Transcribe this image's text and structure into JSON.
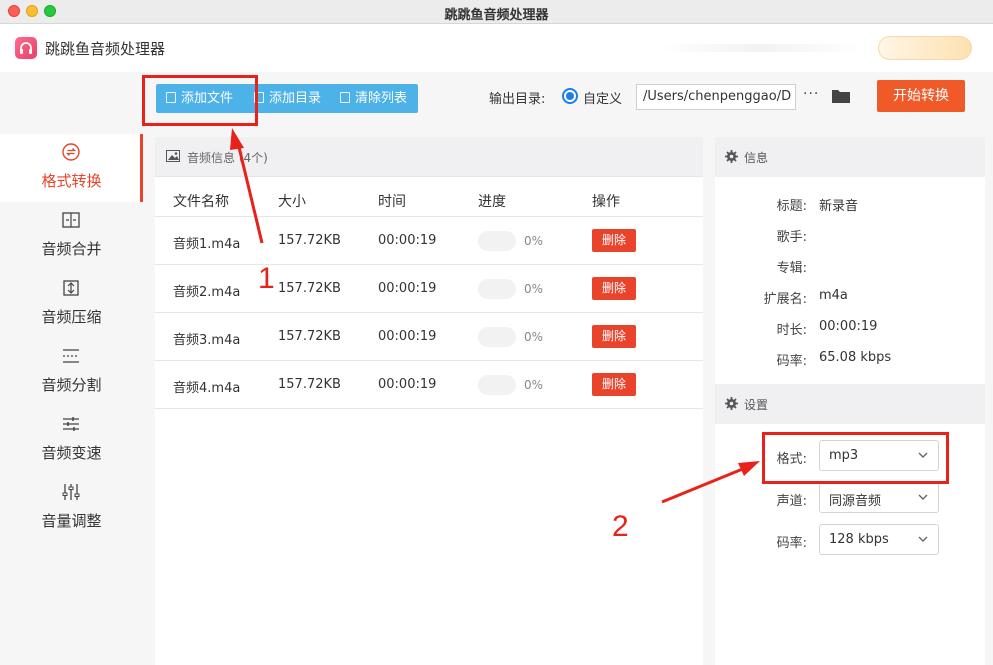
{
  "window": {
    "title": "跳跳鱼音频处理器"
  },
  "app": {
    "name": "跳跳鱼音频处理器"
  },
  "sidebar": {
    "items": [
      {
        "label": "格式转换",
        "icon": "format-convert-icon",
        "active": true
      },
      {
        "label": "音频合并",
        "icon": "merge-icon"
      },
      {
        "label": "音频压缩",
        "icon": "compress-icon"
      },
      {
        "label": "音频分割",
        "icon": "split-icon"
      },
      {
        "label": "音频变速",
        "icon": "speed-icon"
      },
      {
        "label": "音量调整",
        "icon": "volume-adjust-icon"
      }
    ]
  },
  "toolbar": {
    "add_file": "添加文件",
    "add_dir": "添加目录",
    "clear_list": "清除列表",
    "output_label": "输出目录:",
    "radio_custom": "自定义",
    "output_path": "/Users/chenpenggao/D",
    "more": "···",
    "start": "开始转换"
  },
  "file_panel": {
    "title": "音频信息 (4个)",
    "columns": [
      "文件名称",
      "大小",
      "时间",
      "进度",
      "操作"
    ],
    "rows": [
      {
        "name": "音频1.m4a",
        "size": "157.72KB",
        "time": "00:00:19",
        "progress": "0%",
        "action": "删除"
      },
      {
        "name": "音频2.m4a",
        "size": "157.72KB",
        "time": "00:00:19",
        "progress": "0%",
        "action": "删除"
      },
      {
        "name": "音频3.m4a",
        "size": "157.72KB",
        "time": "00:00:19",
        "progress": "0%",
        "action": "删除"
      },
      {
        "name": "音频4.m4a",
        "size": "157.72KB",
        "time": "00:00:19",
        "progress": "0%",
        "action": "删除"
      }
    ]
  },
  "info": {
    "title": "信息",
    "fields": [
      {
        "k": "标题:",
        "v": "新录音"
      },
      {
        "k": "歌手:",
        "v": ""
      },
      {
        "k": "专辑:",
        "v": ""
      },
      {
        "k": "扩展名:",
        "v": "m4a"
      },
      {
        "k": "时长:",
        "v": "00:00:19"
      },
      {
        "k": "码率:",
        "v": "65.08 kbps"
      }
    ]
  },
  "settings": {
    "title": "设置",
    "format_label": "格式:",
    "format_value": "mp3",
    "channel_label": "声道:",
    "channel_value": "同源音频",
    "bitrate_label": "码率:",
    "bitrate_value": "128 kbps"
  },
  "annotations": {
    "step1": "1",
    "step2": "2"
  },
  "colors": {
    "accent": "#e8442c",
    "toolbar_blue": "#4db2e8",
    "start": "#f05a28",
    "annotation": "#e8221a"
  }
}
